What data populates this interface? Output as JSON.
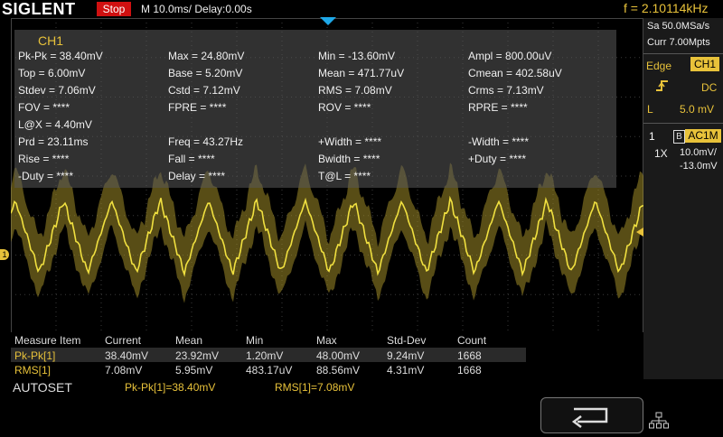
{
  "header": {
    "logo": "SIGLENT",
    "run_state": "Stop",
    "timebase": "M 10.0ms/ Delay:0.00s",
    "frequency": "f = 2.10114kHz"
  },
  "right_panel": {
    "sample_rate": "Sa 50.0MSa/s",
    "memory_depth": "Curr 7.00Mpts",
    "trigger_type": "Edge",
    "trigger_source": "CH1",
    "trigger_coupling": "DC",
    "trigger_level_label": "L",
    "trigger_level": "5.0 mV",
    "channel_number": "1",
    "bandwidth_limit": "B",
    "channel_coupling": "AC1M",
    "probe": "1X",
    "volts_per_div": "10.0mV/",
    "offset": "-13.0mV"
  },
  "measure_panel": {
    "title": "CH1",
    "items": [
      "Pk-Pk = 38.40mV",
      "Max = 24.80mV",
      "Min = -13.60mV",
      "Ampl = 800.00uV",
      "Top = 6.00mV",
      "Base = 5.20mV",
      "Mean = 471.77uV",
      "Cmean = 402.58uV",
      "Stdev = 7.06mV",
      "Cstd = 7.12mV",
      "RMS = 7.08mV",
      "Crms = 7.13mV",
      "FOV = ****",
      "FPRE = ****",
      "ROV = ****",
      "RPRE = ****",
      "L@X = 4.40mV",
      "",
      "",
      "",
      "Prd = 23.11ms",
      "Freq = 43.27Hz",
      "+Width = ****",
      "-Width = ****",
      "Rise = ****",
      "Fall = ****",
      "Bwidth = ****",
      "+Duty = ****",
      "-Duty = ****",
      "Delay = ****",
      "T@L = ****",
      ""
    ]
  },
  "stats_table": {
    "headers": [
      "Measure Item",
      "Current",
      "Mean",
      "Min",
      "Max",
      "Std-Dev",
      "Count"
    ],
    "rows": [
      [
        "Pk-Pk[1]",
        "38.40mV",
        "23.92mV",
        "1.20mV",
        "48.00mV",
        "9.24mV",
        "1668"
      ],
      [
        "RMS[1]",
        "7.08mV",
        "5.95mV",
        "483.17uV",
        "88.56mV",
        "4.31mV",
        "1668"
      ]
    ]
  },
  "footer": {
    "autoset": "AUTOSET",
    "summary_1": "Pk-Pk[1]=38.40mV",
    "summary_2": "RMS[1]=7.08mV"
  },
  "markers": {
    "channel_1": "1"
  },
  "colors": {
    "trace": "#e8c23a",
    "trigger": "#1ea8e8",
    "stop": "#d01010"
  },
  "icons": {
    "back": "back-arrow-icon",
    "network": "network-icon",
    "trigger_edge": "rising-edge-icon"
  }
}
